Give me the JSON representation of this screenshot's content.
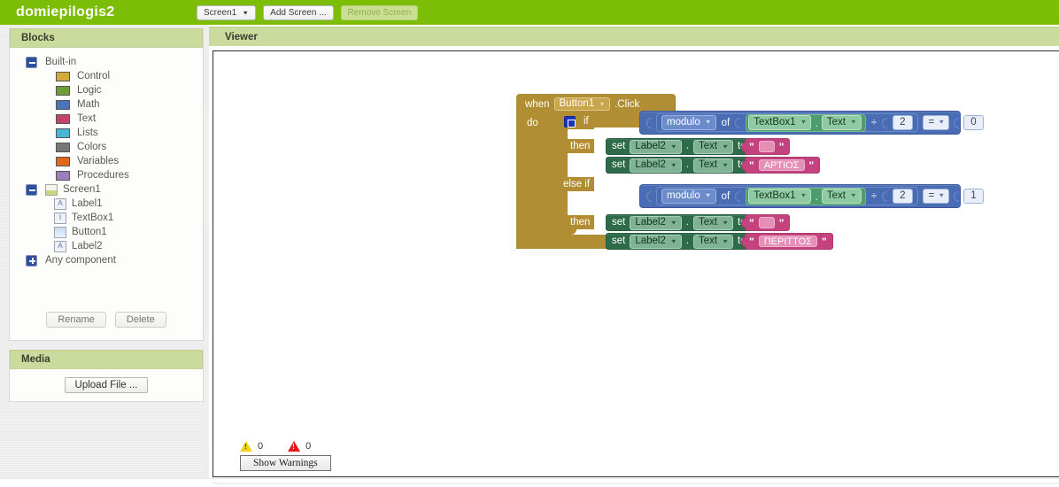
{
  "topbar": {
    "project_title": "domiepilogis2",
    "screen_selector": {
      "label": "Screen1",
      "caret": "▼"
    },
    "add_screen_label": "Add Screen ...",
    "remove_screen_label": "Remove Screen"
  },
  "left": {
    "blocks_panel_title": "Blocks",
    "media_panel_title": "Media",
    "rename_label": "Rename",
    "delete_label": "Delete",
    "upload_file_label": "Upload File ...",
    "tree": {
      "builtin_label": "Built-in",
      "builtin_children": [
        {
          "label": "Control",
          "color": "#d4a93c"
        },
        {
          "label": "Logic",
          "color": "#6d9c38"
        },
        {
          "label": "Math",
          "color": "#4a74b8"
        },
        {
          "label": "Text",
          "color": "#c4436a"
        },
        {
          "label": "Lists",
          "color": "#49b5d8"
        },
        {
          "label": "Colors",
          "color": "#777777"
        },
        {
          "label": "Variables",
          "color": "#e2671a"
        },
        {
          "label": "Procedures",
          "color": "#9a7fbe"
        }
      ],
      "screen_label": "Screen1",
      "screen_children": [
        {
          "label": "Label1",
          "icon": "A"
        },
        {
          "label": "TextBox1",
          "icon": "I"
        },
        {
          "label": "Button1",
          "icon": ""
        },
        {
          "label": "Label2",
          "icon": "A"
        }
      ],
      "any_component_label": "Any component"
    }
  },
  "viewer": {
    "title": "Viewer",
    "warnings": {
      "warning_count": "0",
      "error_count": "0",
      "show_warnings_label": "Show Warnings"
    }
  },
  "blocks": {
    "event": {
      "when_kw": "when",
      "component": "Button1",
      "event_name": ".Click",
      "do_kw": "do",
      "caret": "▼"
    },
    "if_kw": "if",
    "then_kw": "then",
    "else_if_kw": "else if",
    "condition_1": {
      "math_op": "modulo",
      "of_kw": "of",
      "getter_component": "TextBox1",
      "getter_property": "Text",
      "divider": "÷",
      "divisor": "2",
      "comparator": "=",
      "compare_value": "0"
    },
    "condition_2": {
      "math_op": "modulo",
      "of_kw": "of",
      "getter_component": "TextBox1",
      "getter_property": "Text",
      "divider": "÷",
      "divisor": "2",
      "comparator": "=",
      "compare_value": "1"
    },
    "then_1": [
      {
        "set_kw": "set",
        "component": "Label2",
        "property": "Text",
        "to_kw": "to",
        "value": ""
      },
      {
        "set_kw": "set",
        "component": "Label2",
        "property": "Text",
        "to_kw": "to",
        "value": "ΑΡΤΙΟΣ"
      }
    ],
    "then_2": [
      {
        "set_kw": "set",
        "component": "Label2",
        "property": "Text",
        "to_kw": "to",
        "value": ""
      },
      {
        "set_kw": "set",
        "component": "Label2",
        "property": "Text",
        "to_kw": "to",
        "value": "ΠΕΡΙΤΤΟΣ"
      }
    ],
    "quote": "\""
  },
  "colors": {
    "brand_green": "#7bbd07",
    "panel_header_green": "#cbdb9d",
    "control_block": "#b18e33",
    "math_block": "#4a6cb3",
    "getter_block": "#4f9c6b",
    "setter_block": "#2e6b4a",
    "text_block": "#c4437e"
  }
}
